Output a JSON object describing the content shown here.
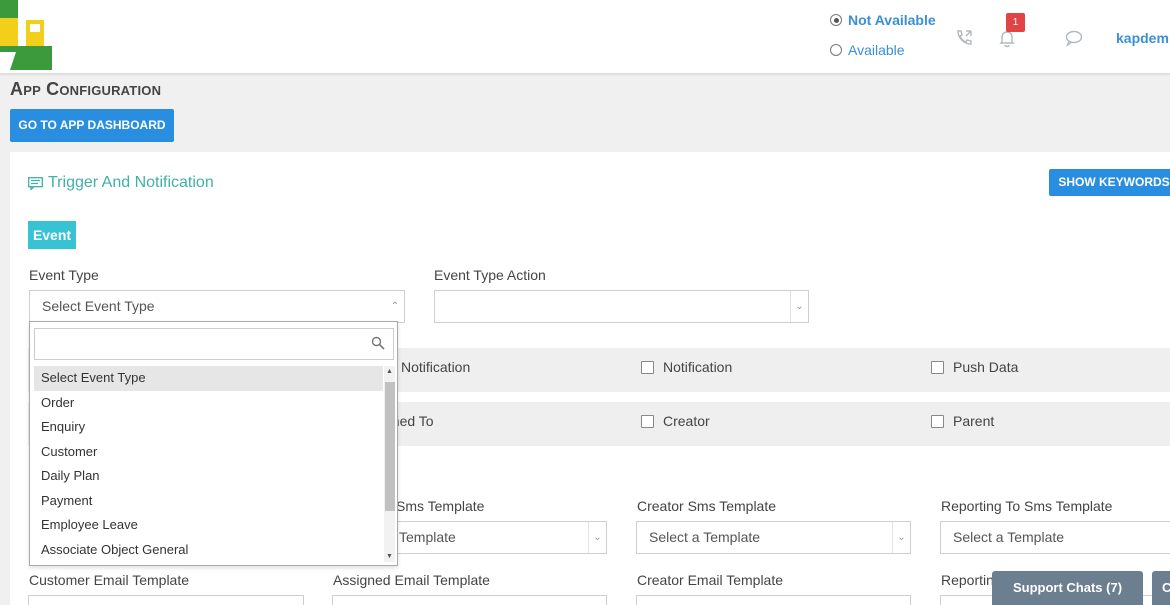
{
  "header": {
    "status_options": [
      {
        "label": "Not Available",
        "selected": true
      },
      {
        "label": "Available",
        "selected": false
      }
    ],
    "notification_count": "1",
    "username": "kapdem"
  },
  "page": {
    "title": "App Configuration",
    "dashboard_button": "GO TO APP DASHBOARD"
  },
  "section": {
    "title": "Trigger And Notification",
    "keywords_button": "SHOW KEYWORDS",
    "event_tag": "Event"
  },
  "form": {
    "event_type_label": "Event Type",
    "event_type_value": "Select Event Type",
    "event_type_action_label": "Event Type Action",
    "row1_checks": [
      "Notification",
      "Notification",
      "Push Data"
    ],
    "row2_checks": [
      "gned To",
      "Creator",
      "Parent"
    ],
    "sms_labels": [
      "Sms Template",
      "Creator Sms Template",
      "Reporting To Sms Template"
    ],
    "sms_values": [
      "Template",
      "Select a Template",
      "Select a Template"
    ],
    "email_labels": [
      "Customer Email Template",
      "Assigned Email Template",
      "Creator Email Template",
      "Reportin"
    ]
  },
  "dropdown": {
    "items": [
      "Select Event Type",
      "Order",
      "Enquiry",
      "Customer",
      "Daily Plan",
      "Payment",
      "Employee Leave",
      "Associate Object General"
    ]
  },
  "footer": {
    "support_chats": "Support Chats (7)",
    "second_button": "C"
  },
  "colors": {
    "accent_blue": "#2a8ee0",
    "teal": "#3fb1a6",
    "event_tag": "#38c3d4",
    "badge_red": "#e04444"
  }
}
